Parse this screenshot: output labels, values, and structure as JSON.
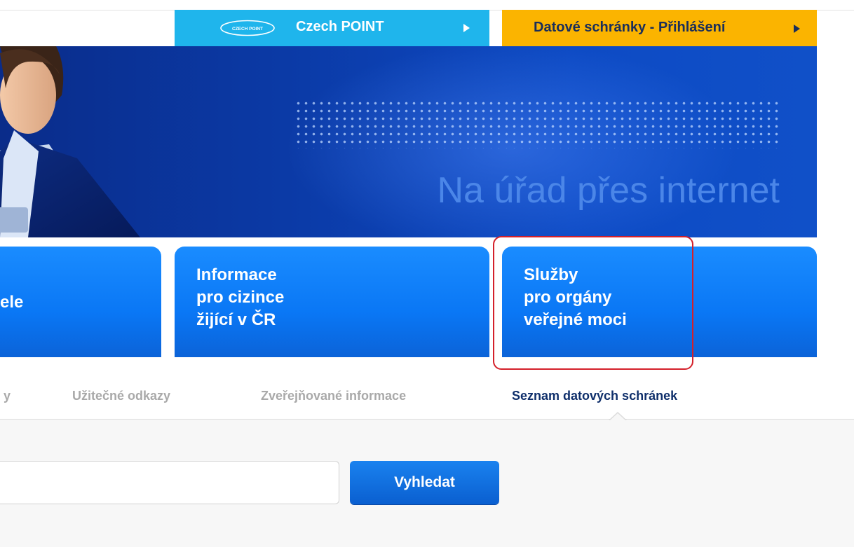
{
  "top_buttons": {
    "czechpoint": {
      "logo_text": "CZECH POINT",
      "label": "Czech POINT"
    },
    "datove_schranky": {
      "label": "Datové schránky - Přihlášení"
    }
  },
  "hero": {
    "slogan": "Na úřad přes internet"
  },
  "tiles": [
    {
      "lines": [
        "",
        "ele",
        ""
      ]
    },
    {
      "lines": [
        "Informace",
        "pro cizince",
        "žijící v ČR"
      ]
    },
    {
      "lines": [
        "Služby",
        "pro orgány",
        "veřejné moci"
      ]
    }
  ],
  "subnav": [
    {
      "label": "y"
    },
    {
      "label": "Užitečné odkazy"
    },
    {
      "label": "Zveřejňované informace"
    },
    {
      "label": "Seznam datových schránek",
      "active": true
    }
  ],
  "search": {
    "value": "",
    "button_label": "Vyhledat"
  },
  "colors": {
    "czechpoint_blue": "#1fb5ec",
    "datove_yellow": "#fbb400",
    "tile_blue": "#0a77f5",
    "highlight_red": "#d4202a",
    "active_nav": "#0f2f6b"
  }
}
